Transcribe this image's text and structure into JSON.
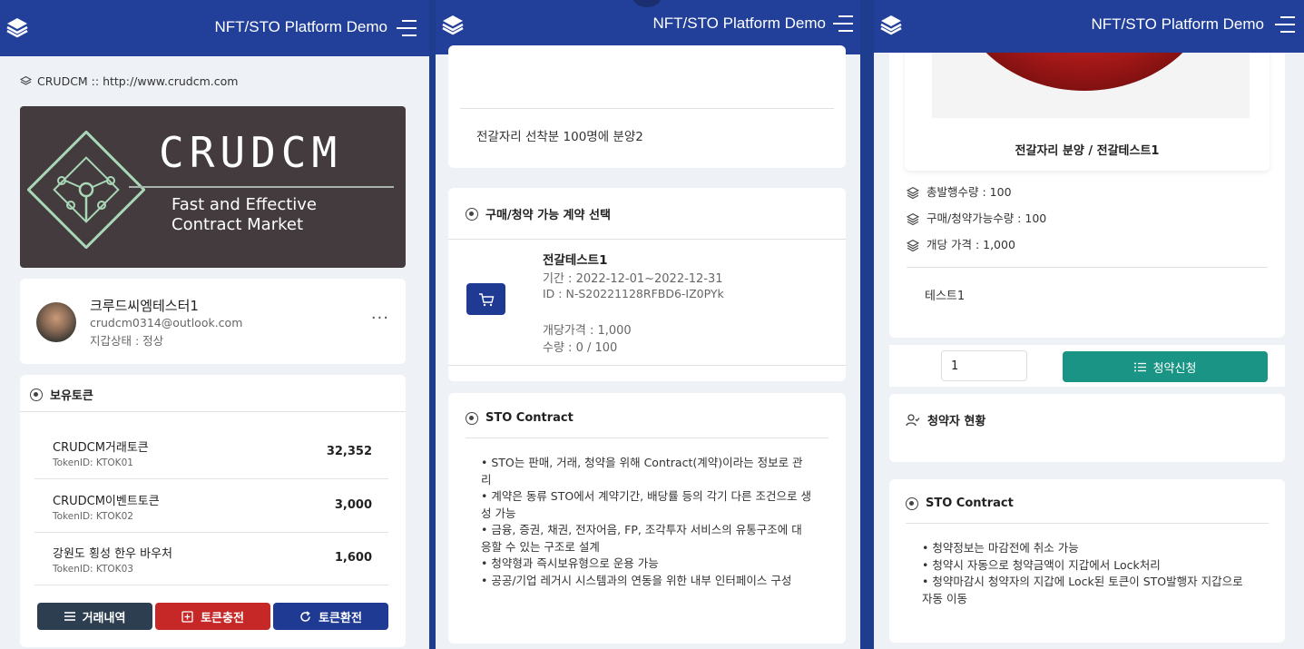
{
  "app": {
    "title": "NFT/STO Platform Demo"
  },
  "panel1": {
    "site": "CRUDCM :: http://www.crudcm.com",
    "banner": {
      "brand": "CRUDCM",
      "line1": "Fast and Effective",
      "line2": "Contract Market"
    },
    "profile": {
      "name": "크루드씨엠테스터1",
      "email": "crudcm0314@outlook.com",
      "status": "지갑상태 : 정상"
    },
    "tokens_title": "보유토큰",
    "tokens": [
      {
        "name": "CRUDCM거래토큰",
        "id": "TokenID: KTOK01",
        "amount": "32,352"
      },
      {
        "name": "CRUDCM이벤트토큰",
        "id": "TokenID: KTOK02",
        "amount": "3,000"
      },
      {
        "name": "강원도 횡성 한우 바우처",
        "id": "TokenID: KTOK03",
        "amount": "1,600"
      }
    ],
    "buttons": {
      "history": "거래내역",
      "charge": "토큰충전",
      "exchange": "토큰환전"
    }
  },
  "panel2": {
    "desc": "전갈자리 선착분 100명에 분양2",
    "contract_section": "구매/청약 가능 계약 선택",
    "contract": {
      "name": "전갈테스트1",
      "period": "기간 : 2022-12-01~2022-12-31",
      "id": "ID : N-S20221128RFBD6-IZ0PYk",
      "price": "개당가격 : 1,000",
      "qty": "수량 : 0 / 100"
    },
    "sto_title": "STO Contract",
    "sto_items": [
      "• STO는 판매, 거래, 청약을 위해 Contract(계약)이라는 정보로 관리",
      "• 계약은 동류 STO에서 계약기간, 배당률 등의 각기 다른 조건으로 생성 가능",
      "• 금융, 증권, 채권, 전자어음, FP, 조각투자 서비스의 유통구조에 대응할 수 있는 구조로 설계",
      "• 청약형과 즉시보유형으로 운용 가능",
      "• 공공/기업 레거시 시스템과의 연동을 위한 내부 인터페이스 구성"
    ]
  },
  "panel3": {
    "item_title": "전갈자리 분양 / 전갈테스트1",
    "stats": [
      "총발행수량 : 100",
      "구매/청약가능수량 : 100",
      "개당 가격 : 1,000"
    ],
    "note": "테스트1",
    "quantity_value": "1",
    "apply_button": "청약신청",
    "subscribers_title": "청약자 현황",
    "sto_title": "STO Contract",
    "sto_items": [
      "• 청약정보는 마감전에 취소 가능",
      "• 청약시 자동으로 청약금액이 지갑에서 Lock처리",
      "• 청약마감시 청약자의 지갑에 Lock된 토큰이 STO발행자 지갑으로 자동 이동"
    ]
  },
  "colors": {
    "header": "#22409a",
    "history_btn": "#2c3e50",
    "charge_btn": "#c62828",
    "exchange_btn": "#1f3a93",
    "apply_btn": "#1a9484"
  }
}
